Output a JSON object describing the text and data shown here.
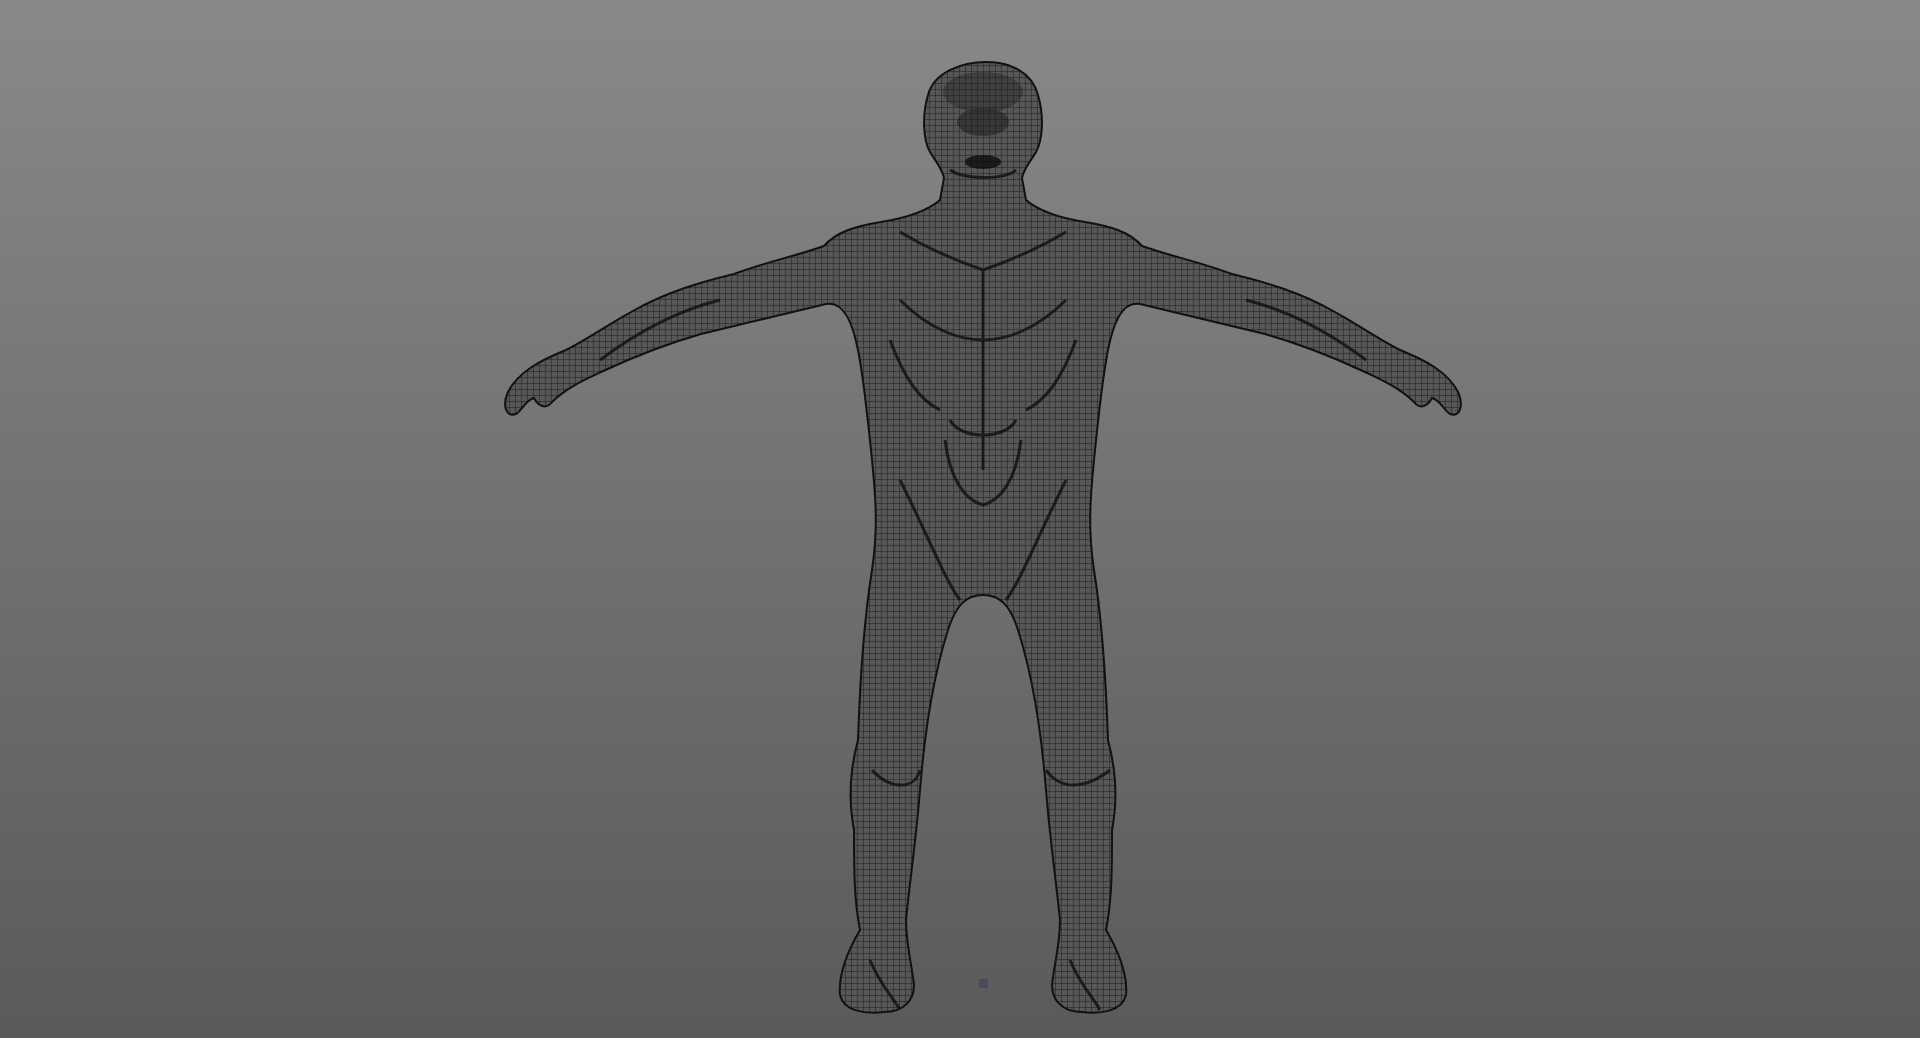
{
  "viewport": {
    "model": {
      "kind": "wireframe"
    },
    "marker": {
      "kind": "square"
    }
  }
}
